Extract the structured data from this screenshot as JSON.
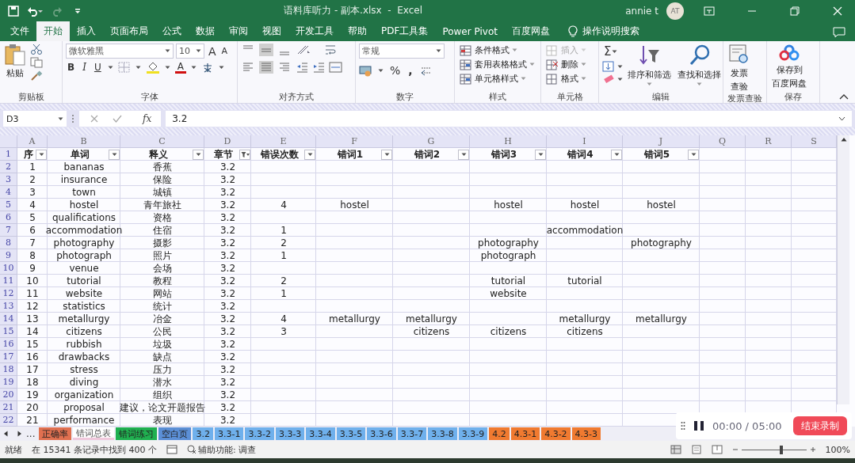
{
  "window": {
    "title": "语料库听力 - 副本.xlsx  -  Excel",
    "user": "annie t",
    "avatar": "AT"
  },
  "tabs": [
    {
      "label": "文件",
      "selected": false
    },
    {
      "label": "开始",
      "selected": true
    },
    {
      "label": "插入",
      "selected": false
    },
    {
      "label": "页面布局",
      "selected": false
    },
    {
      "label": "公式",
      "selected": false
    },
    {
      "label": "数据",
      "selected": false
    },
    {
      "label": "审阅",
      "selected": false
    },
    {
      "label": "视图",
      "selected": false
    },
    {
      "label": "开发工具",
      "selected": false
    },
    {
      "label": "帮助",
      "selected": false
    },
    {
      "label": "PDF工具集",
      "selected": false
    },
    {
      "label": "Power Pivot",
      "selected": false
    },
    {
      "label": "百度网盘",
      "selected": false
    }
  ],
  "tell_me": "操作说明搜索",
  "ribbon": {
    "clipboard": {
      "paste": "粘贴",
      "label": "剪贴板"
    },
    "font": {
      "family": "微软雅黑",
      "size": "10",
      "grow": "A",
      "shrink": "A",
      "bold": "B",
      "italic": "I",
      "underline": "U",
      "font_color_letter": "A",
      "label": "字体"
    },
    "alignment": {
      "label": "对齐方式"
    },
    "number": {
      "format": "常规",
      "percent": "%",
      "comma": ",",
      "label": "数字"
    },
    "styles": {
      "items": [
        "条件格式",
        "套用表格格式",
        "单元格样式"
      ],
      "label": "样式"
    },
    "cells": {
      "items": [
        {
          "label": "插入",
          "disabled": true
        },
        {
          "label": "删除",
          "disabled": false
        },
        {
          "label": "格式",
          "disabled": false
        }
      ],
      "label": "单元格"
    },
    "editing": {
      "sum": "Σ",
      "sort": "排序和筛选",
      "find": "查找和选择",
      "label": "编辑"
    },
    "invoice": {
      "lines": [
        "发票",
        "查验"
      ],
      "label": "发票查验"
    },
    "save": {
      "lines": [
        "保存到",
        "百度网盘"
      ],
      "label": "保存"
    }
  },
  "formula_bar": {
    "name_box": "D3",
    "fx": "fx",
    "value": "3.2"
  },
  "sheet": {
    "columns": [
      "A",
      "B",
      "C",
      "D",
      "E",
      "F",
      "G",
      "H",
      "I",
      "J",
      "Q",
      "R",
      "S"
    ],
    "header_row": "1",
    "header": [
      {
        "text": "序",
        "filtered": false
      },
      {
        "text": "单词",
        "filtered": false
      },
      {
        "text": "释义",
        "filtered": false
      },
      {
        "text": "章节",
        "filtered": true
      },
      {
        "text": "错误次数",
        "filtered": false
      },
      {
        "text": "错词1",
        "filtered": false
      },
      {
        "text": "错词2",
        "filtered": false
      },
      {
        "text": "错词3",
        "filtered": false
      },
      {
        "text": "错词4",
        "filtered": false
      },
      {
        "text": "错词5",
        "filtered": false
      }
    ],
    "rows": [
      {
        "num": "2",
        "cells": [
          "1",
          "bananas",
          "香蕉",
          "3.2",
          "",
          "",
          "",
          "",
          "",
          ""
        ]
      },
      {
        "num": "3",
        "cells": [
          "2",
          "insurance",
          "保险",
          "3.2",
          "",
          "",
          "",
          "",
          "",
          ""
        ]
      },
      {
        "num": "4",
        "cells": [
          "3",
          "town",
          "城镇",
          "3.2",
          "",
          "",
          "",
          "",
          "",
          ""
        ]
      },
      {
        "num": "5",
        "cells": [
          "4",
          "hostel",
          "青年旅社",
          "3.2",
          "4",
          "hostel",
          "",
          "hostel",
          "hostel",
          "hostel"
        ]
      },
      {
        "num": "6",
        "cells": [
          "5",
          "qualifications",
          "资格",
          "3.2",
          "",
          "",
          "",
          "",
          "",
          ""
        ]
      },
      {
        "num": "7",
        "cells": [
          "6",
          "accommodation",
          "住宿",
          "3.2",
          "1",
          "",
          "",
          "",
          "accommodation",
          ""
        ]
      },
      {
        "num": "8",
        "cells": [
          "7",
          "photography",
          "摄影",
          "3.2",
          "2",
          "",
          "",
          "photography",
          "",
          "photography"
        ]
      },
      {
        "num": "9",
        "cells": [
          "8",
          "photograph",
          "照片",
          "3.2",
          "1",
          "",
          "",
          "photograph",
          "",
          ""
        ]
      },
      {
        "num": "10",
        "cells": [
          "9",
          "venue",
          "会场",
          "3.2",
          "",
          "",
          "",
          "",
          "",
          ""
        ]
      },
      {
        "num": "11",
        "cells": [
          "10",
          "tutorial",
          "教程",
          "3.2",
          "2",
          "",
          "",
          "tutorial",
          "tutorial",
          ""
        ]
      },
      {
        "num": "12",
        "cells": [
          "11",
          "website",
          "网站",
          "3.2",
          "1",
          "",
          "",
          "website",
          "",
          ""
        ]
      },
      {
        "num": "13",
        "cells": [
          "12",
          "statistics",
          "统计",
          "3.2",
          "",
          "",
          "",
          "",
          "",
          ""
        ]
      },
      {
        "num": "14",
        "cells": [
          "13",
          "metallurgy",
          "冶金",
          "3.2",
          "4",
          "metallurgy",
          "metallurgy",
          "",
          "metallurgy",
          "metallurgy"
        ]
      },
      {
        "num": "15",
        "cells": [
          "14",
          "citizens",
          "公民",
          "3.2",
          "3",
          "",
          "citizens",
          "citizens",
          "citizens",
          ""
        ]
      },
      {
        "num": "16",
        "cells": [
          "15",
          "rubbish",
          "垃圾",
          "3.2",
          "",
          "",
          "",
          "",
          "",
          ""
        ]
      },
      {
        "num": "17",
        "cells": [
          "16",
          "drawbacks",
          "缺点",
          "3.2",
          "",
          "",
          "",
          "",
          "",
          ""
        ]
      },
      {
        "num": "18",
        "cells": [
          "17",
          "stress",
          "压力",
          "3.2",
          "",
          "",
          "",
          "",
          "",
          ""
        ]
      },
      {
        "num": "19",
        "cells": [
          "18",
          "diving",
          "潜水",
          "3.2",
          "",
          "",
          "",
          "",
          "",
          ""
        ]
      },
      {
        "num": "20",
        "cells": [
          "19",
          "organization",
          "组织",
          "3.2",
          "",
          "",
          "",
          "",
          "",
          ""
        ]
      },
      {
        "num": "21",
        "cells": [
          "20",
          "proposal",
          "建议，论文开题报告",
          "3.2",
          "",
          "",
          "",
          "",
          "",
          ""
        ]
      },
      {
        "num": "22",
        "cells": [
          "21",
          "performance",
          "表现",
          "3.2",
          "",
          "",
          "",
          "",
          "",
          ""
        ]
      }
    ]
  },
  "sheet_tabs": {
    "more": "...",
    "tabs": [
      {
        "label": "正确率",
        "color": "#e07050",
        "selected": false
      },
      {
        "label": "错词总表",
        "color": "#f0c8dc",
        "selected": true
      },
      {
        "label": "错词练习",
        "color": "#20b050",
        "selected": false
      },
      {
        "label": "空白页",
        "color": "#5b8fd6",
        "selected": false
      },
      {
        "label": "3.2",
        "color": "#6fb0ec",
        "selected": false
      },
      {
        "label": "3.3-1",
        "color": "#6fb0ec",
        "selected": false
      },
      {
        "label": "3.3-2",
        "color": "#6fb0ec",
        "selected": false
      },
      {
        "label": "3.3-3",
        "color": "#6fb0ec",
        "selected": false
      },
      {
        "label": "3.3-4",
        "color": "#6fb0ec",
        "selected": false
      },
      {
        "label": "3.3-5",
        "color": "#6fb0ec",
        "selected": false
      },
      {
        "label": "3.3-6",
        "color": "#6fb0ec",
        "selected": false
      },
      {
        "label": "3.3-7",
        "color": "#6fb0ec",
        "selected": false
      },
      {
        "label": "3.3-8",
        "color": "#6fb0ec",
        "selected": false
      },
      {
        "label": "3.3-9",
        "color": "#6fb0ec",
        "selected": false
      },
      {
        "label": "4.2",
        "color": "#f07a30",
        "selected": false
      },
      {
        "label": "4.3-1",
        "color": "#f07a30",
        "selected": false
      },
      {
        "label": "4.3-2",
        "color": "#f07a30",
        "selected": false
      },
      {
        "label": "4.3-3",
        "color": "#f07a30",
        "selected": false
      }
    ]
  },
  "status_bar": {
    "ready": "就绪",
    "records": "在 15341 条记录中找到 400 个",
    "accessibility": "辅助功能: 调查",
    "zoom": "100%",
    "zoom_slider": {
      "level": 0.62
    }
  },
  "recorder": {
    "time": "00:00 / 05:00",
    "stop": "结束录制"
  }
}
